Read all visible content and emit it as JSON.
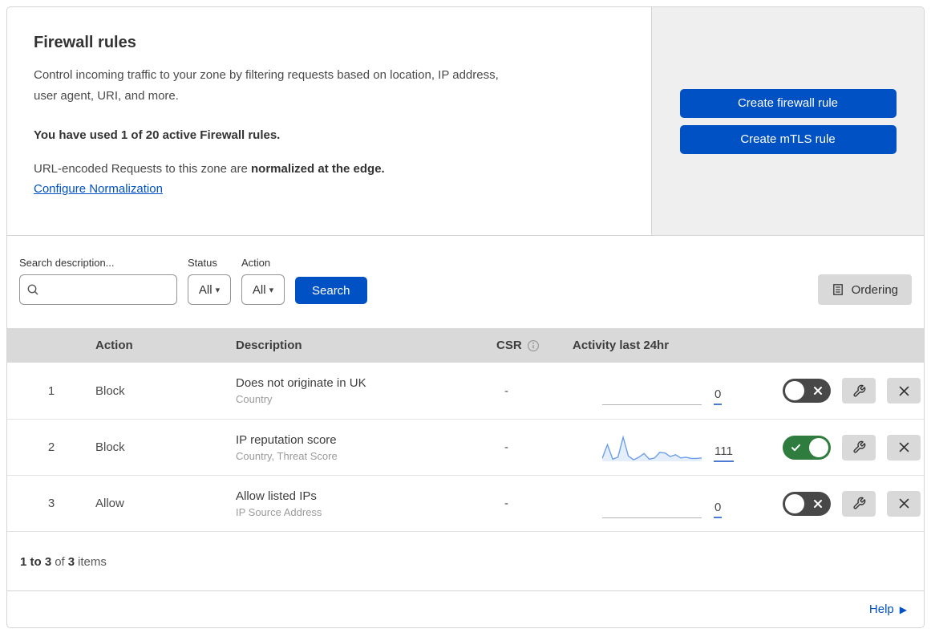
{
  "header": {
    "title": "Firewall rules",
    "description": "Control incoming traffic to your zone by filtering requests based on location, IP address,\nuser agent, URI, and more.",
    "usage": "You have used 1 of 20 active Firewall rules.",
    "normalization_prefix": "URL-encoded Requests to this zone are ",
    "normalization_bold": "normalized at the edge.",
    "normalization_link": "Configure Normalization",
    "create_firewall_button": "Create firewall rule",
    "create_mtls_button": "Create mTLS rule"
  },
  "filters": {
    "search_label": "Search description...",
    "status_label": "Status",
    "status_value": "All",
    "action_label": "Action",
    "action_value": "All",
    "search_button": "Search",
    "ordering_button": "Ordering"
  },
  "icons": {
    "dropdown_caret": "▾",
    "help_arrow": "▶"
  },
  "table": {
    "columns": {
      "action": "Action",
      "description": "Description",
      "csr": "CSR",
      "activity": "Activity last 24hr"
    },
    "rows": [
      {
        "priority": "1",
        "action": "Block",
        "description": "Does not originate in UK",
        "fields": "Country",
        "csr": "-",
        "activity_count": "0",
        "enabled": false,
        "sparkline": []
      },
      {
        "priority": "2",
        "action": "Block",
        "description": "IP reputation score",
        "fields": "Country, Threat Score",
        "csr": "-",
        "activity_count": "111",
        "enabled": true,
        "sparkline": [
          9,
          68,
          6,
          14,
          100,
          19,
          3,
          14,
          30,
          6,
          11,
          35,
          32,
          17,
          25,
          11,
          14,
          9,
          9,
          11
        ]
      },
      {
        "priority": "3",
        "action": "Allow",
        "description": "Allow listed IPs",
        "fields": "IP Source Address",
        "csr": "-",
        "activity_count": "0",
        "enabled": false,
        "sparkline": []
      }
    ]
  },
  "footer": {
    "range_text": "1 to 3",
    "of_text": "of",
    "total_text": "3",
    "items_text": "items",
    "help_label": "Help"
  },
  "colors": {
    "primary_blue": "#0051c3",
    "toggle_on_green": "#2e7d3e",
    "toggle_off_grey": "#484848",
    "sparkline_blue": "#6d9eea",
    "table_header_grey": "#d9d9d9",
    "panel_grey": "#efefef"
  }
}
